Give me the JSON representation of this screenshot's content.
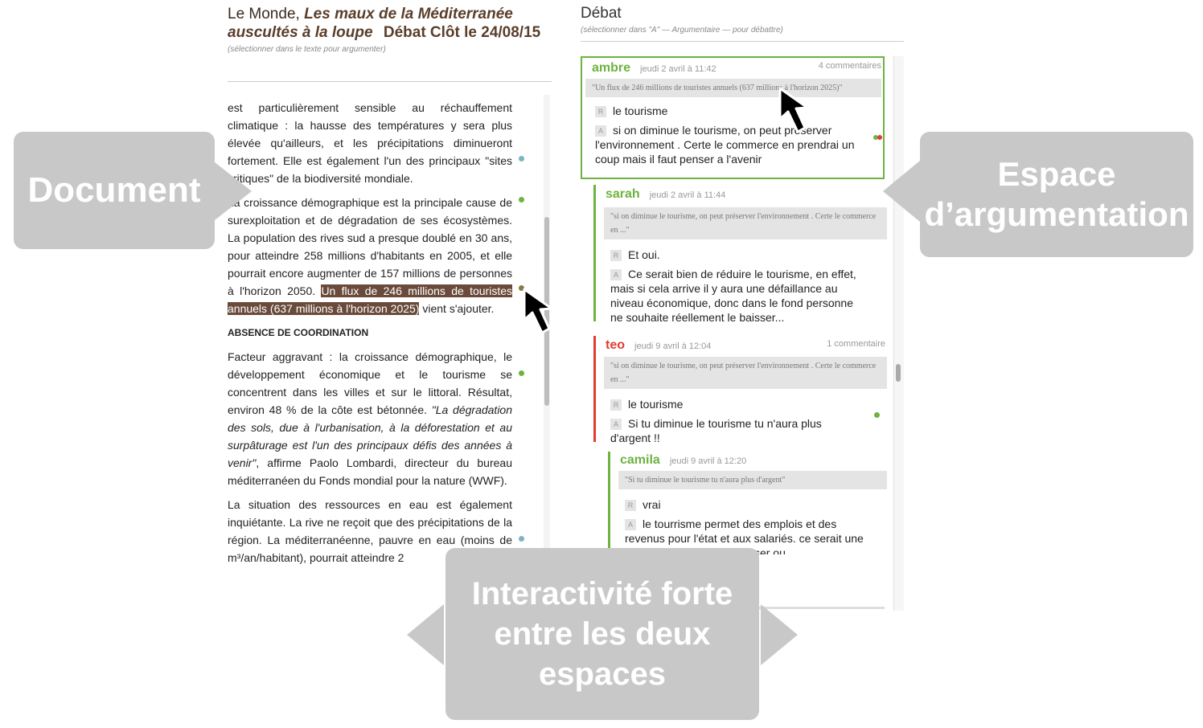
{
  "document": {
    "source": "Le Monde,",
    "article_title": "Les maux de la Méditerranée auscultés à la loupe",
    "debate_status": "Débat Clôt le 24/08/15",
    "hint": "(sélectionner dans le texte pour argumenter)",
    "p1": "est particulièrement sensible au réchauffement climatique : la hausse des températures y sera plus élevée qu'ailleurs, et les précipitations diminueront fortement. Elle est également l'un des principaux \"sites critiques\" de la biodiversité mondiale.",
    "p2_before": "La croissance démographique est la principale cause de surexploitation et de dégradation de ses écosystèmes. La population des rives sud a presque doublé en 30 ans, pour atteindre 258 millions d'habitants en 2005, et elle pourrait encore augmenter de 157 millions de personnes à l'horizon 2050.",
    "p2_highlight": "Un flux de 246 millions de touristes annuels (637 millions à l'horizon 2025)",
    "p2_after": "vient s'ajouter.",
    "heading": "ABSENCE DE COORDINATION",
    "p3_a": "Facteur aggravant : la croissance démographique, le développement économique et le tourisme se concentrent dans les villes et sur le littoral. Résultat, environ 48 % de la côte est bétonnée.",
    "p3_quote": "\"La dégradation des sols, due à l'urbanisation, à la déforestation et au surpâturage est l'un des principaux défis des années à venir\"",
    "p3_b": ", affirme Paolo Lombardi, directeur du bureau méditerranéen du Fonds mondial pour la nature (WWF).",
    "p4": "La situation des ressources en eau est également inquiétante. La rive ne reçoit que des précipitations de la région. La méditerranéenne, pauvre en eau (moins de m³/an/habitant), pourrait atteindre 2"
  },
  "debate": {
    "title": "Débat",
    "hint": "(sélectionner dans \"A\" — Argumentaire — pour débattre)",
    "tag_r": "R",
    "tag_a": "A",
    "cards": [
      {
        "author": "ambre",
        "date": "jeudi 2 avril à 11:42",
        "count": "4 commentaires",
        "quote": "\"Un flux de 246 millions de touristes annuels (637 millions à l'horizon 2025)\"",
        "r": "le tourisme",
        "a": "si on diminue le tourisme, on peut préserver l'environnement . Certe le commerce en prendrai un coup mais il faut penser a l'avenir"
      },
      {
        "author": "sarah",
        "date": "jeudi 2 avril à 11:44",
        "count": "",
        "quote": "\"si on diminue le tourisme, on peut préserver l'environnement . Certe le commerce en ...\"",
        "r": "Et oui.",
        "a": "Ce serait bien de réduire le tourisme, en effet, mais si cela arrive il y aura une défaillance au niveau économique, donc dans le fond personne ne souhaite réellement le baisser..."
      },
      {
        "author": "teo",
        "date": "jeudi 9 avril à 12:04",
        "count": "1 commentaire",
        "quote": "\"si on diminue le tourisme, on peut préserver l'environnement . Certe le commerce en ...\"",
        "r": "le tourisme",
        "a": "Si tu diminue le tourisme tu n'aura plus d'argent !!"
      },
      {
        "author": "camila",
        "date": "jeudi 9 avril à 12:20",
        "count": "",
        "quote": "\"Si tu diminue le tourisme tu n'aura plus d'argent\"",
        "r": "vrai",
        "a": "le tourrisme permet des emplois et des revenus pour l'état et aux salariés. ce serait une perte d'économie de \"baisser ou"
      }
    ]
  },
  "overlays": {
    "document": "Document",
    "argumentation": "Espace d’argumentation",
    "interactivity": "Interactivité forte entre les deux espaces"
  },
  "colors": {
    "green": "#6db33f",
    "red": "#e03c31",
    "brown": "#6a4a3a",
    "overlay": "#c8c8c8",
    "dot_blue": "#7fb2c2"
  }
}
